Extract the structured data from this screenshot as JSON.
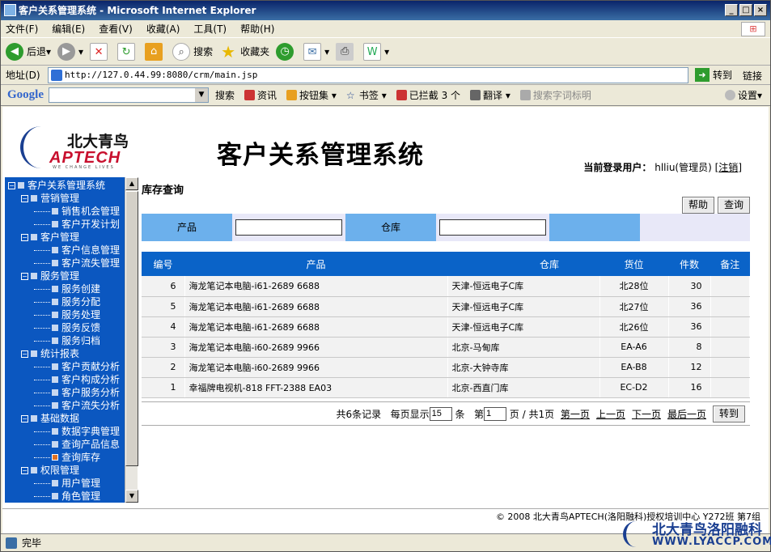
{
  "window": {
    "title": "客户关系管理系统 - Microsoft Internet Explorer",
    "buttons": [
      "_",
      "□",
      "×"
    ]
  },
  "menu": [
    "文件(F)",
    "编辑(E)",
    "查看(V)",
    "收藏(A)",
    "工具(T)",
    "帮助(H)"
  ],
  "toolbar": {
    "back": "后退",
    "search": "搜索",
    "favorites": "收藏夹"
  },
  "address": {
    "label": "地址(D)",
    "url": "http://127.0.44.99:8080/crm/main.jsp",
    "go": "转到",
    "links": "链接"
  },
  "google_bar": {
    "logo": "Google",
    "search": "搜索",
    "news": "资讯",
    "buttons": "按钮集",
    "bookmarks": "书签",
    "blocked": "已拦截 3 个",
    "translate": "翻译",
    "highlight": "搜索字词标明",
    "settings": "设置"
  },
  "header": {
    "logo_cn": "北大青鸟",
    "logo_en": "APTECH",
    "logo_tagline": "WE CHANGE LIVES",
    "system_name": "客户关系管理系统",
    "user_label": "当前登录用户：",
    "user_name": "hlliu(管理员)",
    "logout": "注销"
  },
  "sidebar": {
    "items": [
      {
        "label": "客户关系管理系统",
        "level": 0
      },
      {
        "label": "营销管理",
        "level": 1
      },
      {
        "label": "销售机会管理",
        "level": 2
      },
      {
        "label": "客户开发计划",
        "level": 2
      },
      {
        "label": "客户管理",
        "level": 1
      },
      {
        "label": "客户信息管理",
        "level": 2
      },
      {
        "label": "客户流失管理",
        "level": 2
      },
      {
        "label": "服务管理",
        "level": 1
      },
      {
        "label": "服务创建",
        "level": 2
      },
      {
        "label": "服务分配",
        "level": 2
      },
      {
        "label": "服务处理",
        "level": 2
      },
      {
        "label": "服务反馈",
        "level": 2
      },
      {
        "label": "服务归档",
        "level": 2
      },
      {
        "label": "统计报表",
        "level": 1
      },
      {
        "label": "客户贡献分析",
        "level": 2
      },
      {
        "label": "客户构成分析",
        "level": 2
      },
      {
        "label": "客户服务分析",
        "level": 2
      },
      {
        "label": "客户流失分析",
        "level": 2
      },
      {
        "label": "基础数据",
        "level": 1
      },
      {
        "label": "数据字典管理",
        "level": 2
      },
      {
        "label": "查询产品信息",
        "level": 2
      },
      {
        "label": "查询库存",
        "level": 2,
        "selected": true
      },
      {
        "label": "权限管理",
        "level": 1
      },
      {
        "label": "用户管理",
        "level": 2
      },
      {
        "label": "角色管理",
        "level": 2
      }
    ]
  },
  "main": {
    "title": "库存查询",
    "help_button": "帮助",
    "query_button": "查询",
    "filter": {
      "product_label": "产品",
      "product_value": "",
      "warehouse_label": "仓库",
      "warehouse_value": ""
    },
    "table": {
      "headers": [
        "编号",
        "产品",
        "仓库",
        "货位",
        "件数",
        "备注"
      ],
      "rows": [
        [
          "6",
          "海龙笔记本电脑-i61-2689 6688",
          "天津-恒远电子C库",
          "北28位",
          "30",
          ""
        ],
        [
          "5",
          "海龙笔记本电脑-i61-2689 6688",
          "天津-恒远电子C库",
          "北27位",
          "36",
          ""
        ],
        [
          "4",
          "海龙笔记本电脑-i61-2689 6688",
          "天津-恒远电子C库",
          "北26位",
          "36",
          ""
        ],
        [
          "3",
          "海龙笔记本电脑-i60-2689 9966",
          "北京-马甸库",
          "EA-A6",
          "8",
          ""
        ],
        [
          "2",
          "海龙笔记本电脑-i60-2689 9966",
          "北京-大钟寺库",
          "EA-B8",
          "12",
          ""
        ],
        [
          "1",
          "幸福牌电视机-818 FFT-2388 EA03",
          "北京-西直门库",
          "EC-D2",
          "16",
          ""
        ]
      ]
    },
    "pager": {
      "total": "共6条记录",
      "per_page_label": "每页显示",
      "per_page": "15",
      "per_page_unit": "条",
      "page_label": "第",
      "page": "1",
      "page_of": "页 / 共1页",
      "first": "第一页",
      "prev": "上一页",
      "next": "下一页",
      "last": "最后一页",
      "go": "转到"
    }
  },
  "footer": {
    "copyright": "© 2008 北大青鸟APTECH(洛阳融科)授权培训中心 Y272班 第7组"
  },
  "status": {
    "text": "完毕"
  },
  "watermark": {
    "line1": "北大青鸟洛阳融科",
    "line2": "WWW.LYACCP.COM"
  }
}
